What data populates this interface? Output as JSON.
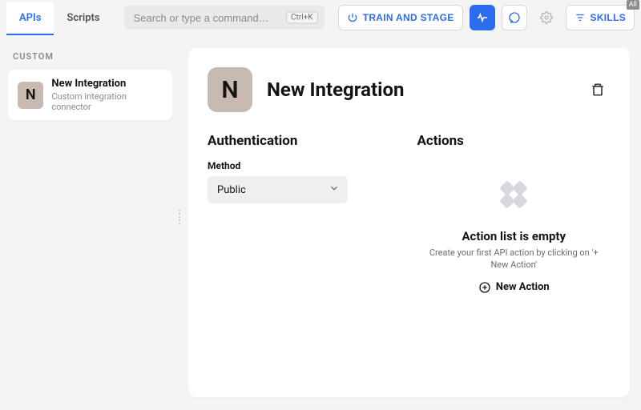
{
  "topbar": {
    "tabs": {
      "apis": "APIs",
      "scripts": "Scripts"
    },
    "search_placeholder": "Search or type a command…",
    "search_shortcut": "Ctrl+K",
    "train_stage": "TRAIN AND STAGE",
    "skills": "SKILLS",
    "badge": "All"
  },
  "sidebar": {
    "section": "CUSTOM",
    "item": {
      "initial": "N",
      "title": "New Integration",
      "subtitle": "Custom integration connector"
    }
  },
  "main": {
    "avatar_initial": "N",
    "title": "New Integration",
    "auth": {
      "heading": "Authentication",
      "method_label": "Method",
      "method_value": "Public"
    },
    "actions": {
      "heading": "Actions",
      "empty_title": "Action list is empty",
      "empty_sub": "Create your first API action by clicking on '+ New Action'",
      "new_action": "New Action"
    }
  }
}
